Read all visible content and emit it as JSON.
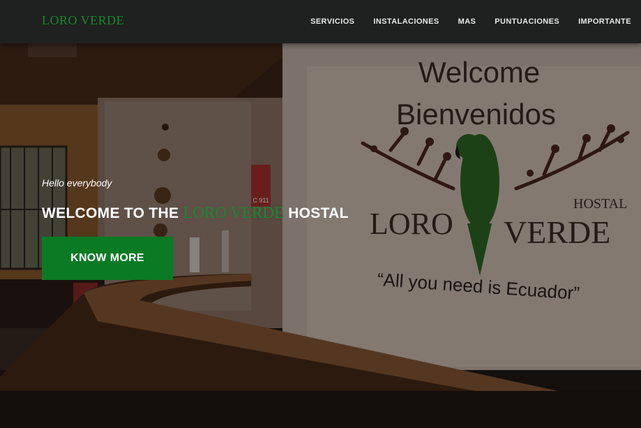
{
  "colors": {
    "brand_green": "#178a2c",
    "button_green": "#0b7a24",
    "navbar_bg": "#1f2020"
  },
  "navbar": {
    "brand": "LORO VERDE",
    "links": [
      "SERVICIOS",
      "INSTALACIONES",
      "MAS",
      "PUNTUACIONES",
      "IMPORTANTE"
    ]
  },
  "hero": {
    "greeting": "Hello everybody",
    "title_prefix": "WELCOME TO THE ",
    "title_brand": "LORO VERDE",
    "title_suffix": " HOSTAL",
    "button_label": "KNOW MORE",
    "photo_sign": {
      "welcome": "Welcome",
      "bienvenidos": "Bienvenidos",
      "loro": "LORO",
      "verde": "VERDE",
      "hostal": "HOSTAL",
      "slogan": "“All you need is Ecuador”",
      "exit_sign": "C 911"
    }
  }
}
